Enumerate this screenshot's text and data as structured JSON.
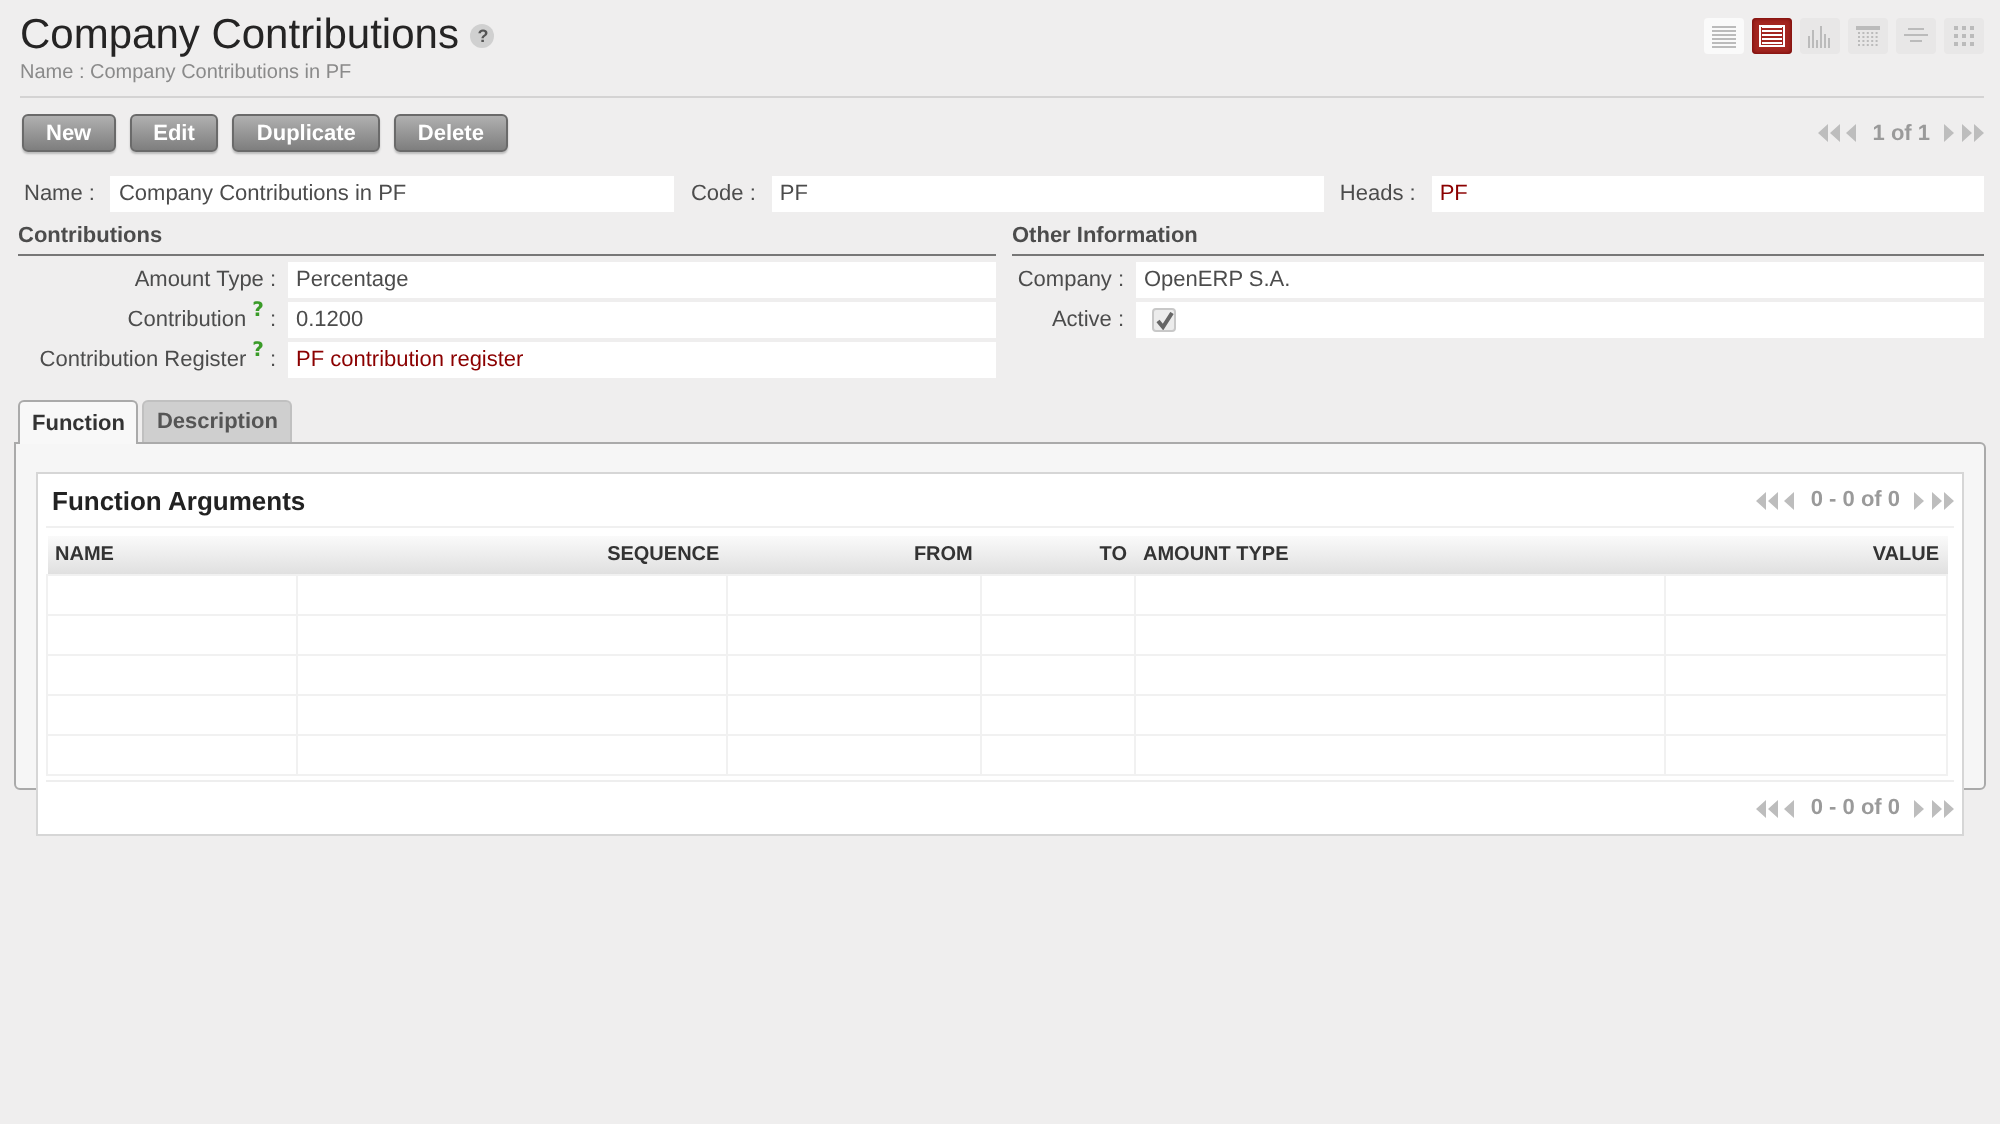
{
  "header": {
    "title": "Company Contributions",
    "help_mark": "?",
    "breadcrumb": "Name : Company Contributions in PF"
  },
  "views": [
    {
      "kind": "list",
      "selected": false
    },
    {
      "kind": "form",
      "selected": true
    },
    {
      "kind": "graph",
      "selected": false
    },
    {
      "kind": "calendar",
      "selected": false
    },
    {
      "kind": "gantt",
      "selected": false
    },
    {
      "kind": "kanban",
      "selected": false
    }
  ],
  "buttons": [
    "New",
    "Edit",
    "Duplicate",
    "Delete"
  ],
  "pager": "1 of 1",
  "top_fields": [
    {
      "label": "Name :",
      "value": "Company Contributions in PF",
      "kind": "text"
    },
    {
      "label": "Code :",
      "value": "PF",
      "kind": "text"
    },
    {
      "label": "Heads :",
      "value": "PF",
      "kind": "link"
    }
  ],
  "groups": [
    {
      "title": "Contributions",
      "fields": [
        {
          "label": "Amount Type",
          "separator": ":",
          "value": "Percentage",
          "kind": "text"
        },
        {
          "label": "Contribution",
          "help_mark": "?",
          "separator": ":",
          "value": "0.1200",
          "kind": "text"
        },
        {
          "label": "Contribution Register",
          "help_mark": "?",
          "separator": ":",
          "value": "PF contribution register",
          "kind": "link"
        }
      ]
    },
    {
      "title": "Other Information",
      "fields": [
        {
          "label": "Company",
          "separator": ":",
          "value": "OpenERP S.A.",
          "kind": "text"
        },
        {
          "label": "Active",
          "separator": ":",
          "kind": "checkbox",
          "checked": true,
          "disabled": true
        }
      ]
    }
  ],
  "tabs": [
    {
      "label": "Function",
      "selected": true
    },
    {
      "label": "Description",
      "selected": false
    }
  ],
  "list": {
    "title": "Function Arguments",
    "pager_top": "0 - 0 of 0",
    "pager_bottom": "0 - 0 of 0",
    "columns": [
      {
        "label": "NAME"
      },
      {
        "label": "SEQUENCE"
      },
      {
        "label": "FROM"
      },
      {
        "label": "TO"
      },
      {
        "label": "AMOUNT TYPE"
      },
      {
        "label": "VALUE"
      }
    ]
  }
}
